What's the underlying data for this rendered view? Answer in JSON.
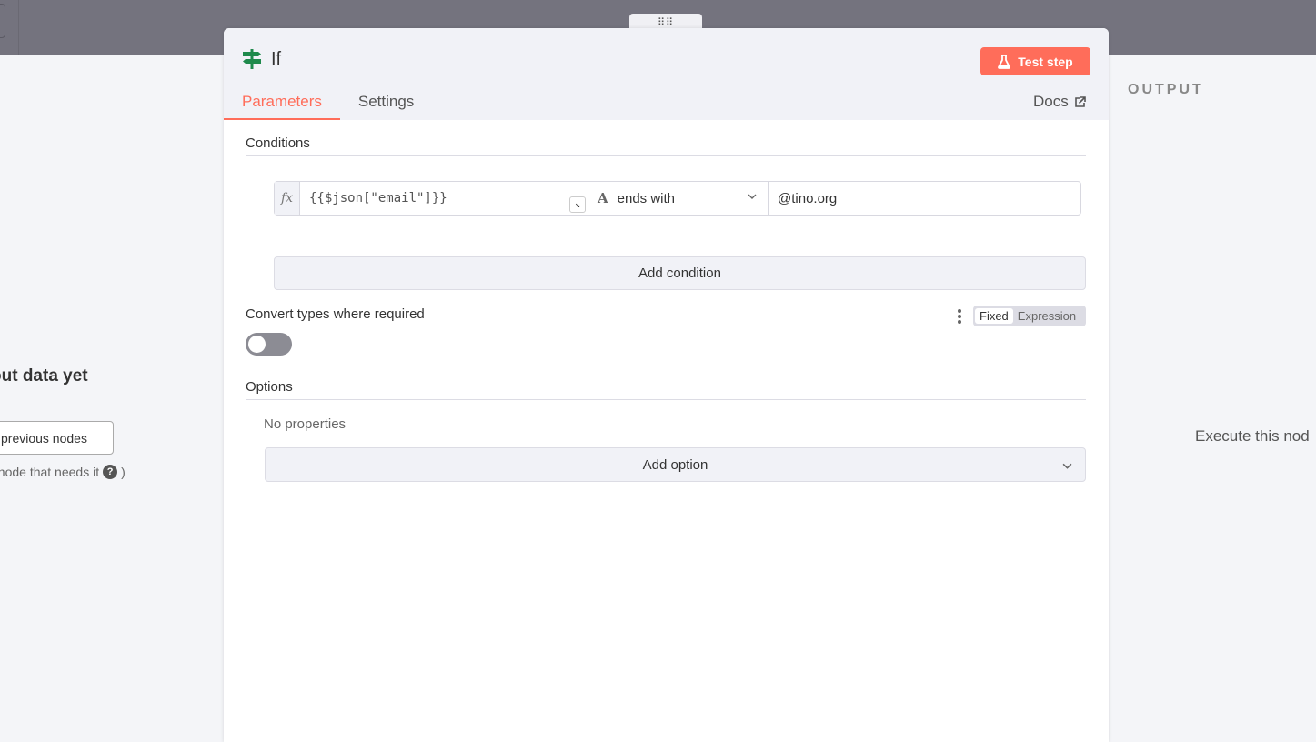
{
  "input_panel": {
    "title": "out data yet",
    "button_label": "previous nodes",
    "hint": "t node that needs it",
    "hint_suffix": ")",
    "help_glyph": "?"
  },
  "output_panel": {
    "title": "OUTPUT",
    "message": "Execute this nod"
  },
  "node": {
    "title": "If",
    "icon": "signpost-icon",
    "test_button_label": "Test step",
    "docs_label": "Docs",
    "tabs": [
      {
        "label": "Parameters",
        "active": true
      },
      {
        "label": "Settings",
        "active": false
      }
    ]
  },
  "conditions": {
    "label": "Conditions",
    "fx_label": "fx",
    "row": {
      "left_value": "{{$json[\"email\"]}}",
      "operator": "ends with",
      "operator_type_glyph": "A",
      "right_value": "@tino.org"
    },
    "add_label": "Add condition"
  },
  "convert_types": {
    "label": "Convert types where required",
    "enabled": false,
    "modes": [
      "Fixed",
      "Expression"
    ],
    "active_mode": "Fixed"
  },
  "options": {
    "label": "Options",
    "empty_text": "No properties",
    "add_label": "Add option"
  },
  "colors": {
    "accent": "#ff6d5a",
    "node_icon": "#1f8a4c"
  }
}
